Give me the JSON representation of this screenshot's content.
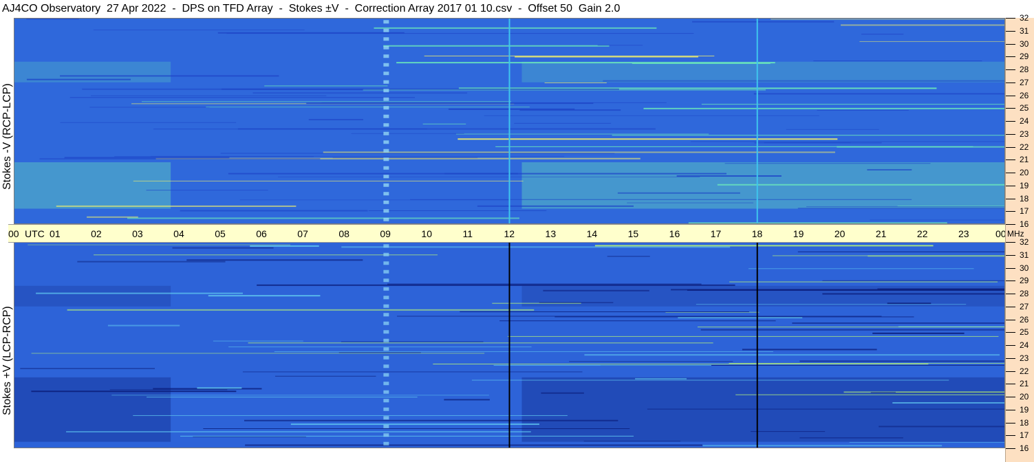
{
  "title": "AJ4CO Observatory  27 Apr 2022  -  DPS on TFD Array  -  Stokes ±V  -  Correction Array 2017 01 10.csv  -  Offset 50  Gain 2.0",
  "panels": [
    {
      "ylabel": "Stokes -V (RCP-LCP)",
      "polarity": "minus",
      "colors": {
        "base": "#2f68db",
        "dark": "#1f47c8",
        "bright": "#6ff0b8",
        "hot": "#f3f06a",
        "marker": "#3fc6ee"
      }
    },
    {
      "ylabel": "Stokes +V (LCP-RCP)",
      "polarity": "plus",
      "colors": {
        "base": "#2d63d8",
        "dark": "#0c1f7d",
        "bright": "#5fc5ef",
        "hot": "#b4f07a",
        "marker": "#000000"
      }
    }
  ],
  "time_axis": {
    "labels": [
      "00",
      "01",
      "02",
      "03",
      "04",
      "05",
      "06",
      "07",
      "08",
      "09",
      "10",
      "11",
      "12",
      "13",
      "14",
      "15",
      "16",
      "17",
      "18",
      "19",
      "20",
      "21",
      "22",
      "23",
      "00"
    ],
    "first_suffix": "UTC"
  },
  "freq_axis": {
    "labels": [
      "16",
      "17",
      "18",
      "19",
      "20",
      "21",
      "22",
      "23",
      "24",
      "25",
      "26",
      "27",
      "28",
      "29",
      "30",
      "31",
      "32"
    ],
    "unit": "MHz"
  },
  "chart_data": [
    {
      "type": "heatmap",
      "title": "AJ4CO Observatory  27 Apr 2022  -  DPS on TFD Array  -  Stokes ±V  -  Correction Array 2017 01 10.csv  -  Offset 50  Gain 2.0",
      "ylabel": "Stokes -V (RCP-LCP)",
      "x_range_utc_hours": [
        0,
        24
      ],
      "y_range_mhz": [
        16,
        32
      ],
      "x_ticks": [
        "00",
        "01",
        "02",
        "03",
        "04",
        "05",
        "06",
        "07",
        "08",
        "09",
        "10",
        "11",
        "12",
        "13",
        "14",
        "15",
        "16",
        "17",
        "18",
        "19",
        "20",
        "21",
        "22",
        "23",
        "00"
      ],
      "y_ticks": [
        16,
        17,
        18,
        19,
        20,
        21,
        22,
        23,
        24,
        25,
        26,
        27,
        28,
        29,
        30,
        31,
        32
      ],
      "marker_times_utc": [
        12,
        18
      ],
      "enhanced_bands_mhz": [
        [
          17.2,
          20.8
        ],
        [
          27.0,
          28.6
        ]
      ],
      "colormap": "blue-cyan-yellow"
    },
    {
      "type": "heatmap",
      "ylabel": "Stokes +V (LCP-RCP)",
      "x_range_utc_hours": [
        0,
        24
      ],
      "y_range_mhz": [
        16,
        32
      ],
      "x_ticks": [
        "00",
        "01",
        "02",
        "03",
        "04",
        "05",
        "06",
        "07",
        "08",
        "09",
        "10",
        "11",
        "12",
        "13",
        "14",
        "15",
        "16",
        "17",
        "18",
        "19",
        "20",
        "21",
        "22",
        "23",
        "00"
      ],
      "y_ticks": [
        16,
        17,
        18,
        19,
        20,
        21,
        22,
        23,
        24,
        25,
        26,
        27,
        28,
        29,
        30,
        31,
        32
      ],
      "marker_times_utc": [
        12,
        18
      ],
      "depleted_bands_mhz": [
        [
          16.5,
          21.5
        ],
        [
          27.0,
          28.6
        ]
      ],
      "colormap": "blue-cyan-yellow"
    }
  ]
}
